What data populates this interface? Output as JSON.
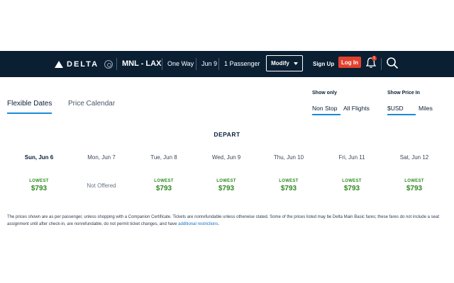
{
  "header": {
    "brand": "DELTA",
    "route": "MNL - LAX",
    "trip_type": "One Way",
    "date": "Jun 9",
    "passengers": "1 Passenger",
    "modify_label": "Modify",
    "signup_label": "Sign Up",
    "login_label": "Log In",
    "notification_count": "1",
    "colors": {
      "bar": "#0b1f33",
      "login": "#e2412e"
    }
  },
  "tabs": [
    {
      "label": "Flexible Dates",
      "active": true
    },
    {
      "label": "Price Calendar",
      "active": false
    }
  ],
  "filters": {
    "show_only": {
      "label": "Show only",
      "options": [
        "Non Stop",
        "All Flights"
      ],
      "selected": "Non Stop"
    },
    "show_price_in": {
      "label": "Show Price In",
      "options": [
        "$USD",
        "Miles"
      ],
      "selected": "$USD"
    }
  },
  "depart_label": "DEPART",
  "days": [
    {
      "label": "Sun, Jun 6",
      "lowest": "LOWEST",
      "price": "$793",
      "selected": true
    },
    {
      "label": "Mon, Jun 7",
      "status": "Not Offered"
    },
    {
      "label": "Tue, Jun 8",
      "lowest": "LOWEST",
      "price": "$793"
    },
    {
      "label": "Wed, Jun 9",
      "lowest": "LOWEST",
      "price": "$793"
    },
    {
      "label": "Thu, Jun 10",
      "lowest": "LOWEST",
      "price": "$793"
    },
    {
      "label": "Fri, Jun 11",
      "lowest": "LOWEST",
      "price": "$793"
    },
    {
      "label": "Sat, Jun 12",
      "lowest": "LOWEST",
      "price": "$793"
    }
  ],
  "disclaimer": {
    "text": "The prices shown are as per passenger, unless shopping with a Companion Certificate. Tickets are nonrefundable unless otherwise stated. Some of the prices listed may be Delta Main Basic fares; these fares do not include a seat assignment until after check-in, are nonrefundable, do not permit ticket changes, and have ",
    "link": "additional restrictions",
    "end": "."
  },
  "accent_color": "#1b8ad8",
  "price_color": "#2f8a20"
}
